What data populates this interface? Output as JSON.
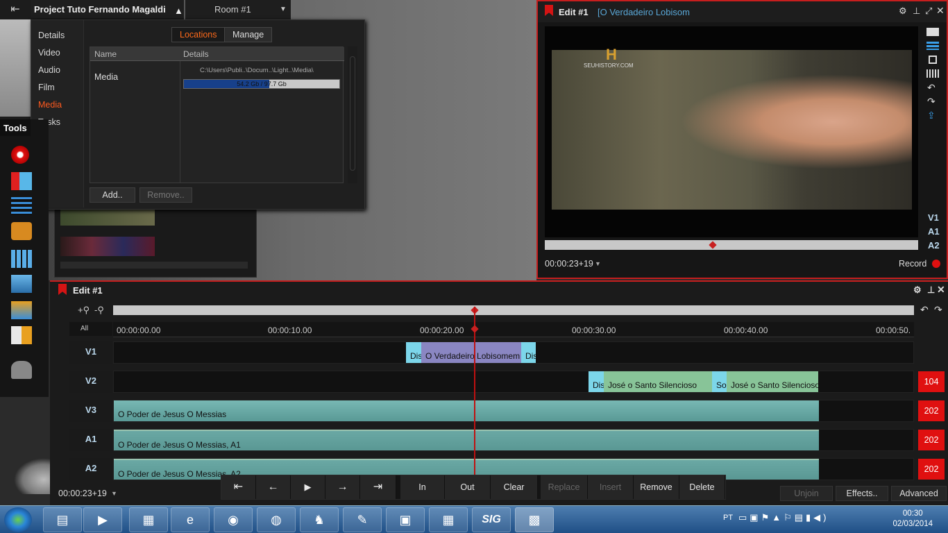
{
  "project": {
    "title": "Project Tuto Fernando Magaldi",
    "room": "Room #1"
  },
  "project_menu": {
    "nav": [
      "Details",
      "Video",
      "Audio",
      "Film",
      "Media",
      "Tasks"
    ],
    "active_nav": "Media",
    "tabs": [
      "Locations",
      "Manage"
    ],
    "table_headers": [
      "Name",
      "Details"
    ],
    "row": {
      "name": "Media",
      "path": "C:\\Users\\Publi..\\Docum..\\Light..\\Media\\",
      "usage": "54.2 Gb / 97.7 Gb",
      "usage_fraction": 0.55
    },
    "add_label": "Add..",
    "remove_label": "Remove.."
  },
  "tools": {
    "label": "Tools"
  },
  "viewer": {
    "title": "Edit #1",
    "subtitle": "[O Verdadeiro Lobisom",
    "timecode": "00:00:23+19",
    "record_label": "Record",
    "tracks": [
      "V1",
      "A1",
      "A2"
    ],
    "logo_text": "SEUHISTORY.COM"
  },
  "timeline": {
    "title": "Edit #1",
    "all_label": "All",
    "ruler": [
      "00:00:00.00",
      "00:00:10.00",
      "00:00:20.00",
      "00:00:30.00",
      "00:00:40.00",
      "00:00:50."
    ],
    "tracks": [
      {
        "label": "V1",
        "count": ""
      },
      {
        "label": "V2",
        "count": "104"
      },
      {
        "label": "V3",
        "count": "202"
      },
      {
        "label": "A1",
        "count": "202"
      },
      {
        "label": "A2",
        "count": "202"
      }
    ],
    "v1_clips": [
      "Dis",
      "O Verdadeiro Lobisomem",
      "Dis"
    ],
    "v2_clips": [
      "Dis",
      "José o Santo Silencioso",
      "So",
      "José o Santo Silencioso"
    ],
    "v3_clip": "O Poder de Jesus   O Messias",
    "a1_clip": "O Poder de Jesus   O Messias, A1",
    "a2_clip": "O Poder de Jesus   O Messias, A2",
    "timecode": "00:00:23+19"
  },
  "transport": {
    "buttons": [
      "In",
      "Out",
      "Clear",
      "Replace",
      "Insert",
      "Remove",
      "Delete"
    ],
    "unjoin": "Unjoin",
    "effects": "Effects..",
    "advanced": "Advanced"
  },
  "taskbar": {
    "lang": "PT",
    "time": "00:30",
    "date": "02/03/2014",
    "ie_label": "SIG"
  }
}
